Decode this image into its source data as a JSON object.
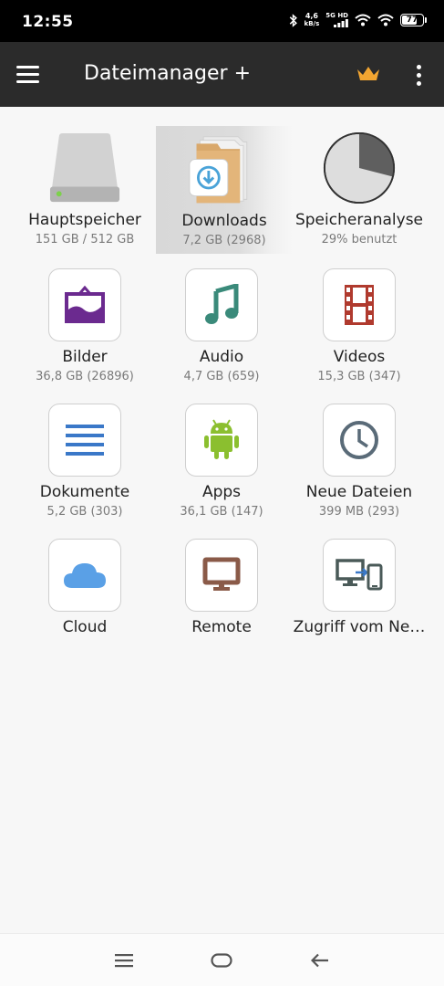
{
  "status_bar": {
    "time": "12:55",
    "net_speed_value": "4,6",
    "net_speed_unit": "kB/s",
    "net_type": "5G HD",
    "battery": "77",
    "battery_fraction": 0.77
  },
  "app_bar": {
    "title": "Dateimanager +",
    "crown_color": "#f2a531"
  },
  "tiles": [
    {
      "label": "Hauptspeicher",
      "sub": "151 GB / 512 GB",
      "icon": "hard-drive-icon"
    },
    {
      "label": "Downloads",
      "sub": "7,2 GB (2968)",
      "icon": "downloads-folder-icon",
      "selected": true
    },
    {
      "label": "Speicheranalyse",
      "sub": "29% benutzt",
      "icon": "storage-pie-icon",
      "used_fraction": 0.29
    },
    {
      "label": "Bilder",
      "sub": "36,8 GB (26896)",
      "icon": "picture-frame-icon",
      "color": "#6b2a8f"
    },
    {
      "label": "Audio",
      "sub": "4,7 GB (659)",
      "icon": "music-note-icon",
      "color": "#3a8a7a"
    },
    {
      "label": "Videos",
      "sub": "15,3 GB (347)",
      "icon": "film-strip-icon",
      "color": "#b03a2e"
    },
    {
      "label": "Dokumente",
      "sub": "5,2 GB (303)",
      "icon": "document-lines-icon",
      "color": "#3a78c8"
    },
    {
      "label": "Apps",
      "sub": "36,1 GB (147)",
      "icon": "android-icon",
      "color": "#8bbf2f"
    },
    {
      "label": "Neue Dateien",
      "sub": "399 MB (293)",
      "icon": "clock-icon",
      "color": "#5a6b78"
    },
    {
      "label": "Cloud",
      "sub": "",
      "icon": "cloud-icon",
      "color": "#5aa0e6"
    },
    {
      "label": "Remote",
      "sub": "",
      "icon": "monitor-icon",
      "color": "#8a5a48"
    },
    {
      "label": "Zugriff vom Ne…",
      "sub": "",
      "icon": "devices-icon",
      "color": "#4a5a58"
    }
  ],
  "nav_bar": {
    "recents": "recents-icon",
    "home": "home-icon",
    "back": "back-arrow-icon"
  }
}
